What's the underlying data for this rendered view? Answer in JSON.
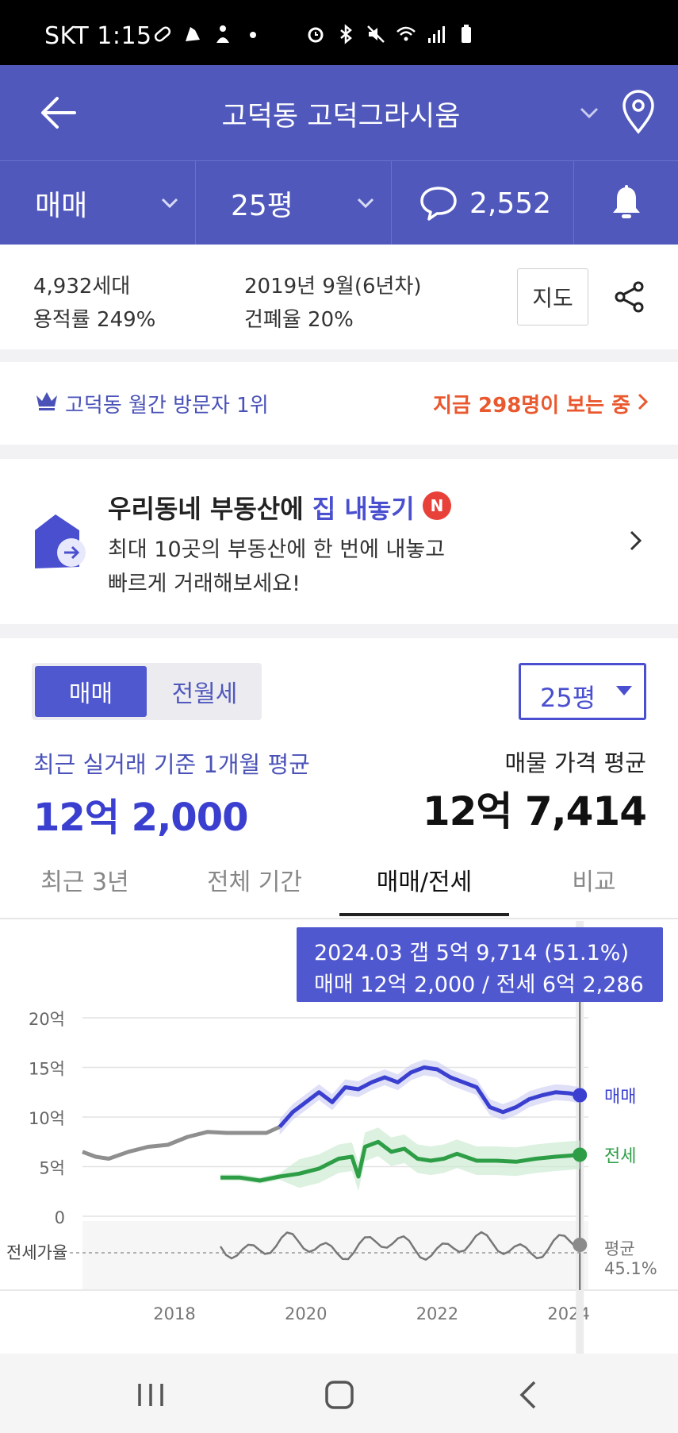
{
  "status_bar": {
    "carrier_time": "SKT 1:15",
    "icons": [
      "pill-icon",
      "shoe-icon",
      "person-icon",
      "dot-icon",
      "alarm-icon",
      "bluetooth-icon",
      "mute-icon",
      "wifi-icon",
      "signal-icon",
      "battery-icon"
    ]
  },
  "header": {
    "title": "고덕동 고덕그라시움",
    "back_icon": "arrow-left-icon",
    "location_icon": "map-pin-icon"
  },
  "filters": {
    "deal_type": "매매",
    "size": "25평",
    "comment_count": "2,552",
    "alarm_icon": "bell-icon"
  },
  "info": {
    "households": "4,932세대",
    "floor_area_ratio": "용적률 249%",
    "built": "2019년 9월(6년차)",
    "coverage_ratio": "건폐율 20%",
    "map_button": "지도"
  },
  "rank": {
    "text": "고덕동 월간 방문자 1위",
    "viewers": "지금 298명이 보는 중"
  },
  "promo": {
    "title_prefix": "우리동네 부동산에 ",
    "title_accent": "집 내놓기",
    "badge": "N",
    "desc_line1": "최대 10곳의 부동산에 한 번에 내놓고",
    "desc_line2": "빠르게 거래해보세요!"
  },
  "segment": {
    "active": "매매",
    "inactive": "전월세",
    "size_select": "25평"
  },
  "price": {
    "recent_label": "최근 실거래 기준 1개월 평균",
    "recent_value": "12억 2,000",
    "listing_label": "매물 가격 평균",
    "listing_value": "12억 7,414"
  },
  "tabs": [
    {
      "label": "최근 3년"
    },
    {
      "label": "전체 기간"
    },
    {
      "label": "매매/전세"
    },
    {
      "label": "비교"
    }
  ],
  "tooltip": {
    "line1": "2024.03  갭 5억 9,714 (51.1%)",
    "line2": "매매 12억 2,000 / 전세 6억 2,286"
  },
  "colors": {
    "brand": "#5058bc",
    "sale": "#3a3fd0",
    "jeonse": "#2e9e46",
    "ratio": "#777777",
    "alert": "#e9582e"
  },
  "chart_data": {
    "type": "line",
    "y_tick_labels": [
      "20억",
      "15억",
      "10억",
      "5억",
      "0"
    ],
    "y_ticks": [
      20,
      15,
      10,
      5,
      0
    ],
    "x_tick_labels": [
      "2018",
      "2020",
      "2022",
      "2024"
    ],
    "x_ticks": [
      2018,
      2020,
      2022,
      2024
    ],
    "xlim": [
      2016.6,
      2024.3
    ],
    "ylim": [
      0,
      20
    ],
    "ratio_label": "전세가율",
    "series": [
      {
        "name": "매매",
        "color": "#3a3fd0",
        "x": [
          2016.6,
          2016.8,
          2017.0,
          2017.3,
          2017.6,
          2017.9,
          2018.2,
          2018.5,
          2018.8,
          2019.1,
          2019.4,
          2019.6,
          2019.8,
          2020.0,
          2020.2,
          2020.4,
          2020.6,
          2020.8,
          2021.0,
          2021.2,
          2021.4,
          2021.6,
          2021.8,
          2022.0,
          2022.2,
          2022.4,
          2022.6,
          2022.8,
          2023.0,
          2023.2,
          2023.4,
          2023.6,
          2023.8,
          2024.0,
          2024.17
        ],
        "y": [
          6.5,
          6.0,
          5.8,
          6.5,
          7.0,
          7.2,
          8.0,
          8.5,
          8.4,
          8.4,
          8.4,
          9.0,
          10.5,
          11.5,
          12.5,
          11.5,
          13.0,
          12.8,
          13.5,
          14.0,
          13.5,
          14.5,
          15.0,
          14.8,
          14.0,
          13.5,
          13.0,
          11.0,
          10.5,
          11.0,
          11.8,
          12.2,
          12.5,
          12.4,
          12.2
        ]
      },
      {
        "name": "전세",
        "color": "#2e9e46",
        "x": [
          2018.7,
          2019.0,
          2019.3,
          2019.6,
          2019.9,
          2020.2,
          2020.5,
          2020.7,
          2020.8,
          2020.9,
          2021.1,
          2021.3,
          2021.5,
          2021.7,
          2021.9,
          2022.1,
          2022.3,
          2022.6,
          2022.9,
          2023.2,
          2023.5,
          2023.8,
          2024.0,
          2024.17
        ],
        "y": [
          3.9,
          3.9,
          3.6,
          4.0,
          4.3,
          4.8,
          5.8,
          6.0,
          4.0,
          7.0,
          7.5,
          6.5,
          6.8,
          5.8,
          5.6,
          5.8,
          6.3,
          5.6,
          5.6,
          5.5,
          5.8,
          6.0,
          6.1,
          6.2
        ]
      }
    ],
    "ratio_series": {
      "name": "전세가율",
      "avg_label": "평균",
      "avg_value": "45.1%"
    }
  },
  "nav": {
    "recents_icon": "recents-icon",
    "home_icon": "home-icon",
    "back_icon": "back-icon"
  }
}
